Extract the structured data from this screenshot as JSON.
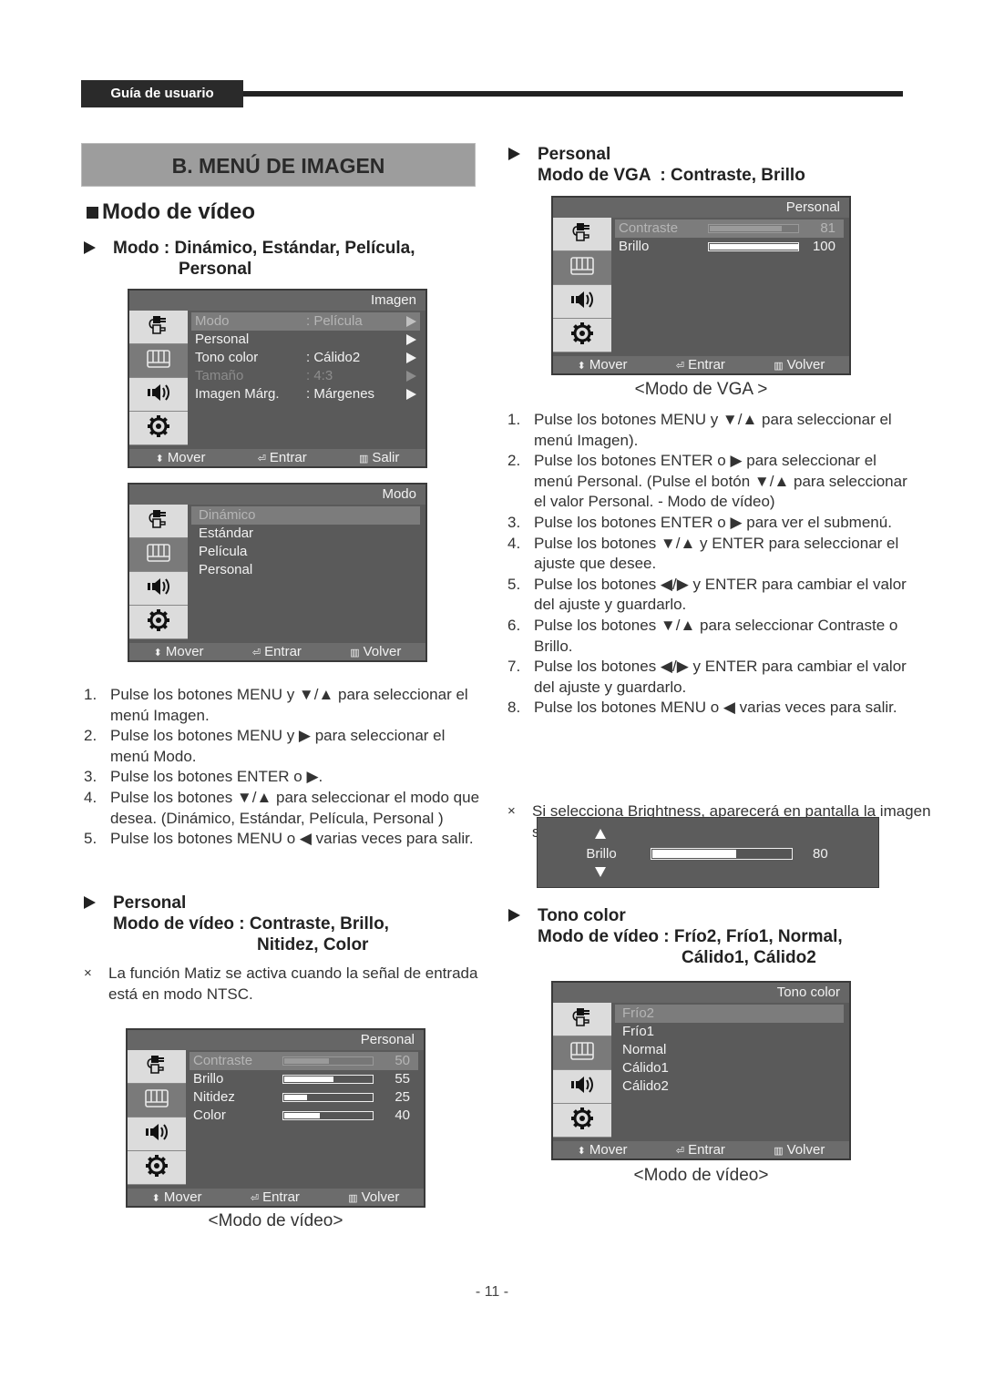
{
  "header": {
    "tab_label": "Guía de usuario"
  },
  "section_title": "B. MENÚ DE IMAGEN",
  "page_number": "- 11 -",
  "left": {
    "heading": "Modo de vídeo",
    "sub1": {
      "line1": "Modo : Dinámico, Estándar, Película,",
      "line2": "Personal"
    },
    "osd_imagen": {
      "title": "Imagen",
      "rows": [
        {
          "label": "Modo",
          "value": ": Película",
          "state": "sel"
        },
        {
          "label": "Personal",
          "value": "",
          "state": ""
        },
        {
          "label": "Tono color",
          "value": ": Cálido2",
          "state": ""
        },
        {
          "label": "Tamaño",
          "value": ": 4:3",
          "state": "dim"
        },
        {
          "label": "Imagen Márg.",
          "value": ": Márgenes",
          "state": ""
        }
      ],
      "footer": {
        "move": "Mover",
        "enter": "Entrar",
        "back": "Salir"
      }
    },
    "osd_modo": {
      "title": "Modo",
      "items": [
        "Dinámico",
        "Estándar",
        "Película",
        "Personal"
      ],
      "selected_index": 0,
      "footer": {
        "move": "Mover",
        "enter": "Entrar",
        "back": "Volver"
      }
    },
    "steps": [
      {
        "n": "1.",
        "text": "Pulse los botones MENU y ▼/▲ para seleccionar el menú Imagen."
      },
      {
        "n": "2.",
        "text": "Pulse los botones MENU y ▶ para seleccionar el menú Modo."
      },
      {
        "n": "3.",
        "text": "Pulse los botones ENTER o ▶."
      },
      {
        "n": "4.",
        "text": "Pulse los botones ▼/▲ para seleccionar el modo que desea. (Dinámico, Estándar, Película, Personal )"
      },
      {
        "n": "5.",
        "text": "Pulse los botones MENU o ◀ varias veces para salir."
      }
    ],
    "sub2": {
      "line1": "Personal",
      "line2": "Modo de vídeo : Contraste, Brillo,",
      "line3": "Nitidez, Color"
    },
    "note": {
      "mark": "×",
      "text": "La función Matiz se activa cuando la señal de entrada está en modo NTSC."
    },
    "osd_personal": {
      "title": "Personal",
      "rows": [
        {
          "label": "Contraste",
          "value": 50
        },
        {
          "label": "Brillo",
          "value": 55
        },
        {
          "label": "Nitidez",
          "value": 25
        },
        {
          "label": "Color",
          "value": 40
        }
      ],
      "selected_index": 0,
      "footer": {
        "move": "Mover",
        "enter": "Entrar",
        "back": "Volver"
      }
    },
    "caption": "<Modo de vídeo>"
  },
  "right": {
    "sub1": {
      "line1": "Personal",
      "line2": "Modo de VGA  : Contraste, Brillo"
    },
    "osd_vga": {
      "title": "Personal",
      "rows": [
        {
          "label": "Contraste",
          "value": 81
        },
        {
          "label": "Brillo",
          "value": 100
        }
      ],
      "selected_index": 0,
      "footer": {
        "move": "Mover",
        "enter": "Entrar",
        "back": "Volver"
      }
    },
    "caption_vga": "<Modo de VGA >",
    "steps": [
      {
        "n": "1.",
        "text": "Pulse los botones MENU y ▼/▲ para seleccionar el menú Imagen)."
      },
      {
        "n": "2.",
        "text": "Pulse los botones ENTER o ▶ para seleccionar el menú Personal. (Pulse el botón ▼/▲ para seleccionar el valor Personal. - Modo de vídeo)"
      },
      {
        "n": "3.",
        "text": "Pulse los botones ENTER o ▶ para ver el submenú."
      },
      {
        "n": "4.",
        "text": "Pulse los botones ▼/▲ y ENTER para seleccionar el ajuste que desee."
      },
      {
        "n": "5.",
        "text": "Pulse los botones ◀/▶ y ENTER para cambiar el valor del ajuste y guardarlo."
      },
      {
        "n": "6.",
        "text": "Pulse los botones ▼/▲ para seleccionar Contraste o Brillo."
      },
      {
        "n": "7.",
        "text": "Pulse los botones ◀/▶ y ENTER para cambiar el valor del ajuste y guardarlo."
      },
      {
        "n": "8.",
        "text": "Pulse los botones MENU o ◀ varias veces para salir."
      }
    ],
    "note": {
      "mark": "×",
      "text": "Si selecciona Brightness, aparecerá en pantalla la imagen siguiente."
    },
    "brillo_popup": {
      "label": "Brillo",
      "value": 80
    },
    "sub2": {
      "line1": "Tono color",
      "line2": "Modo de vídeo : Frío2, Frío1, Normal,",
      "line3": "Cálido1, Cálido2"
    },
    "osd_tono": {
      "title": "Tono color",
      "items": [
        "Frío2",
        "Frío1",
        "Normal",
        "Cálido1",
        "Cálido2"
      ],
      "selected_index": 0,
      "footer": {
        "move": "Mover",
        "enter": "Entrar",
        "back": "Volver"
      }
    },
    "caption_tono": "<Modo de vídeo>"
  }
}
